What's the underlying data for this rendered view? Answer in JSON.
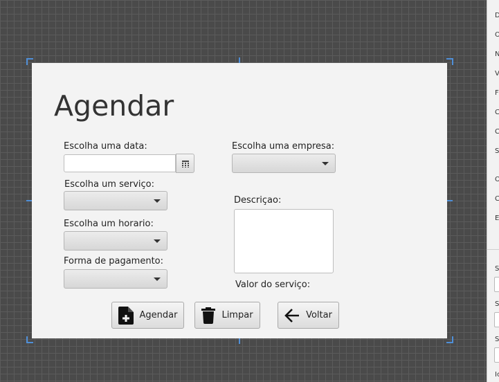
{
  "form": {
    "title": "Agendar",
    "labels": {
      "date": "Escolha uma data:",
      "service": "Escolha um serviço:",
      "time": "Escolha um horario:",
      "payment": "Forma de pagamento:",
      "company": "Escolha uma empresa:",
      "description": "Descriçao:",
      "service_value": "Valor do serviço:"
    },
    "inputs": {
      "date_value": "",
      "service_value": "",
      "time_value": "",
      "payment_value": "",
      "company_value": "",
      "description_value": ""
    },
    "buttons": {
      "schedule": "Agendar",
      "clear": "Limpar",
      "back": "Voltar"
    }
  },
  "side_panel": {
    "labels": [
      "D",
      "O",
      "N",
      "V",
      "F",
      "C",
      "C",
      "S",
      "O",
      "C",
      "E",
      "S",
      "S",
      "S",
      "Ic"
    ]
  },
  "icons": {
    "calendar": "calendar-icon",
    "add_file": "add-file-icon",
    "trash": "trash-icon",
    "back_arrow": "arrow-left-icon"
  },
  "colors": {
    "selection_handles": "#4f8fd8",
    "canvas_background": "#f3f3f3",
    "workspace_grid": "#4a4a4a"
  }
}
